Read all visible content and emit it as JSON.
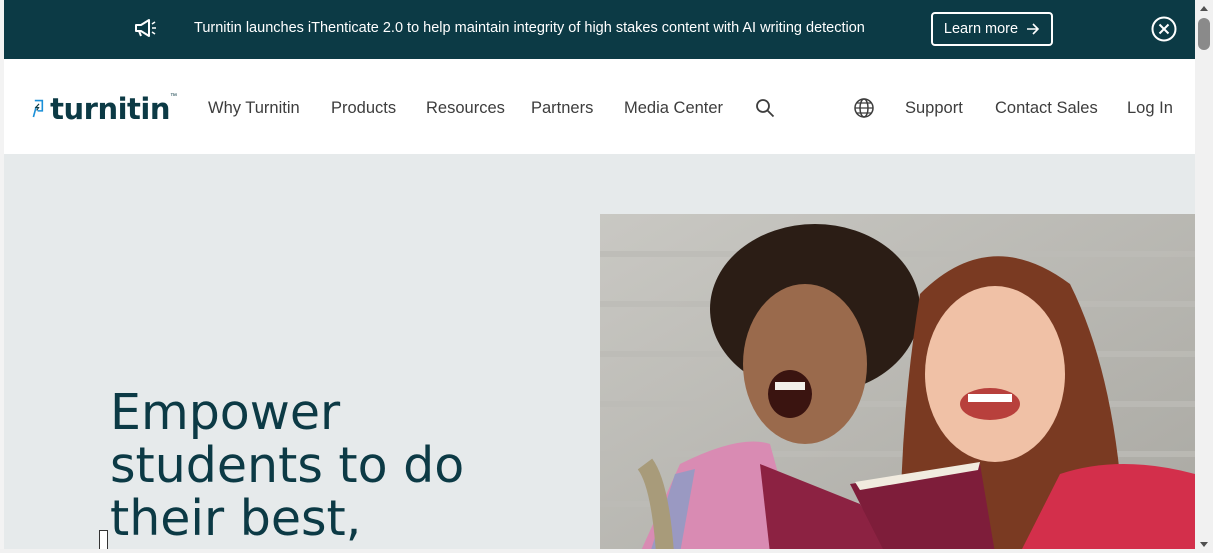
{
  "banner": {
    "message": "Turnitin launches iThenticate 2.0 to help maintain integrity of high stakes content with AI writing detection",
    "cta_label": "Learn more",
    "icon": "megaphone-icon",
    "close_icon": "close-circle-icon",
    "background": "#0c3a45"
  },
  "header": {
    "logo_text": "turnitin",
    "logo_tm": "™",
    "nav": [
      {
        "label": "Why Turnitin"
      },
      {
        "label": "Products"
      },
      {
        "label": "Resources"
      },
      {
        "label": "Partners"
      },
      {
        "label": "Media Center"
      }
    ],
    "search_icon": "search-icon",
    "globe_icon": "globe-icon",
    "right_links": [
      {
        "label": "Support"
      },
      {
        "label": "Contact Sales"
      },
      {
        "label": "Log In"
      }
    ]
  },
  "hero": {
    "title_line1": "Empower",
    "title_line2": "students to do",
    "title_line3": "their best,",
    "background": "#e6eaeb",
    "image": "two-students-laughing-reading-book-photo"
  },
  "colors": {
    "brand_dark": "#0c3a45",
    "brand_blue": "#1a8fd8",
    "nav_text": "#3d3d3d"
  }
}
